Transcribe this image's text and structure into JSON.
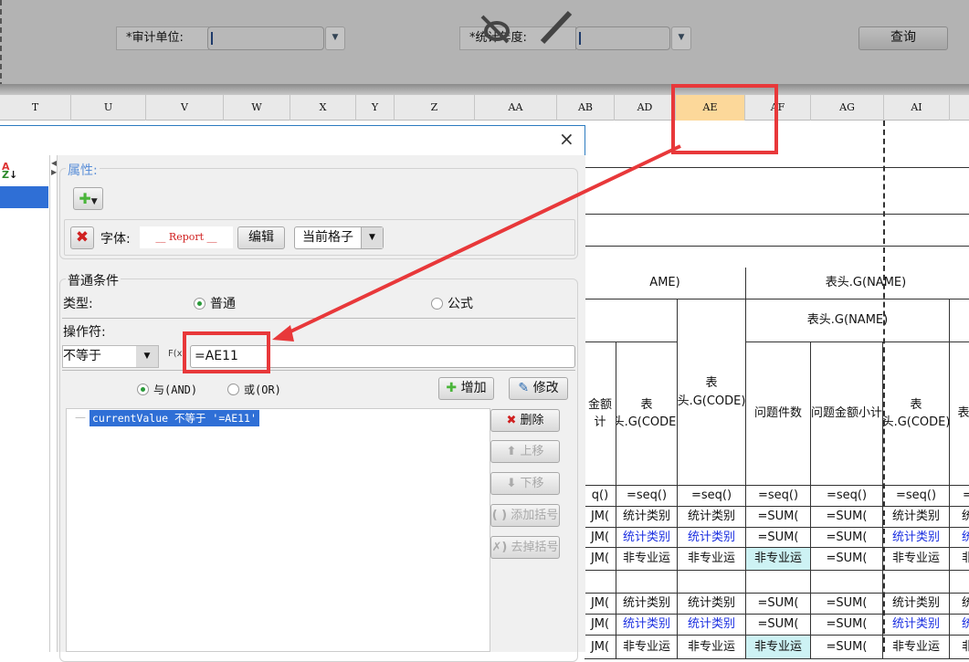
{
  "query_bar": {
    "audit_unit_label": "*审计单位:",
    "stat_year_label": "*统计年度:",
    "query_button": "查询"
  },
  "column_headers": [
    "T",
    "U",
    "V",
    "W",
    "X",
    "Y",
    "Z",
    "AA",
    "AB",
    "AD",
    "AE",
    "AF",
    "AG",
    "AI"
  ],
  "selected_column": "AE",
  "dialog": {
    "close": "×",
    "properties_legend": "属性:",
    "font_label": "字体:",
    "font_sample": "Report",
    "edit_button": "编辑",
    "scope_select": "当前格子",
    "condition_legend": "普通条件",
    "type_label": "类型:",
    "type_options": [
      "普通",
      "公式"
    ],
    "operator_label": "操作符:",
    "operator_value": "不等于",
    "fx_label": "F(x)",
    "formula_value": "=AE11",
    "logic_options": [
      "与(AND)",
      "或(OR)"
    ],
    "add_button": "增加",
    "modify_button": "修改",
    "conditions": [
      "currentValue 不等于 '=AE11'"
    ],
    "side_buttons": [
      "删除",
      "上移",
      "下移",
      "添加括号",
      "去掉括号"
    ]
  },
  "sheet": {
    "header_name_left": "AME)",
    "header_name_right": "表头.G(NAME)",
    "header_name_sub": "表头.G(NAME)",
    "header_code_tall": "表头.G(CODE)",
    "row_header": [
      "金额计",
      "表头.G(CODE)",
      "问题件数",
      "问题金额小计",
      "表头.G(CODE)",
      "表C"
    ],
    "rows": [
      [
        "q()",
        "=seq()",
        "=seq()",
        "=seq()",
        "=seq()",
        "=seq()",
        "="
      ],
      [
        "JM(",
        "统计类别",
        "统计类别",
        "=SUM(",
        "=SUM(",
        "统计类别",
        "统"
      ],
      [
        "JM(",
        "统计类别",
        "统计类别",
        "=SUM(",
        "=SUM(",
        "统计类别",
        "统"
      ],
      [
        "JM(",
        "非专业运",
        "非专业运",
        "非专业运",
        "=SUM(",
        "非专业运",
        "非"
      ],
      [
        "",
        "",
        "",
        "",
        "",
        "",
        ""
      ],
      [
        "JM(",
        "统计类别",
        "统计类别",
        "=SUM(",
        "=SUM(",
        "统计类别",
        "统"
      ],
      [
        "JM(",
        "统计类别",
        "统计类别",
        "=SUM(",
        "=SUM(",
        "统计类别",
        "统"
      ],
      [
        "JM(",
        "非专业运",
        "非专业运",
        "非专业运",
        "=SUM(",
        "非专业运",
        "非"
      ]
    ]
  },
  "colors": {
    "highlight_col": "#fcd89a",
    "annotation": "#e8383a",
    "selection": "#2f6fd6"
  }
}
